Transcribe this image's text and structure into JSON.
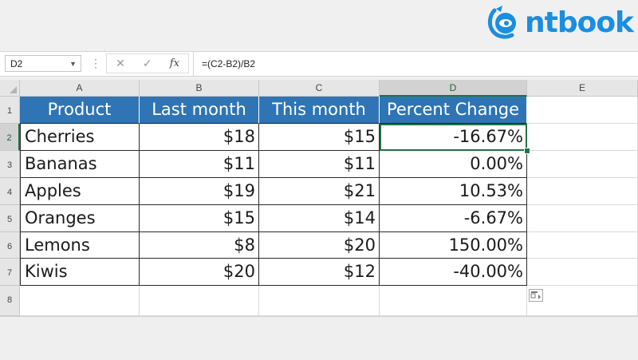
{
  "logo": {
    "text": "ntbook",
    "color": "#1a8ee0"
  },
  "formula_bar": {
    "name_box": "D2",
    "formula": "=(C2-B2)/B2",
    "icons": [
      "more-dots-icon",
      "cancel-icon",
      "enter-icon",
      "function-icon"
    ],
    "fx_label": "fx"
  },
  "columns": [
    "A",
    "B",
    "C",
    "D",
    "E"
  ],
  "rows": [
    "1",
    "2",
    "3",
    "4",
    "5",
    "6",
    "7",
    "8"
  ],
  "selected_cell": "D2",
  "table": {
    "headers": [
      "Product",
      "Last month",
      "This month",
      "Percent Change"
    ],
    "rows": [
      [
        "Cherries",
        "$18",
        "$15",
        "-16.67%"
      ],
      [
        "Bananas",
        "$11",
        "$11",
        "0.00%"
      ],
      [
        "Apples",
        "$19",
        "$21",
        "10.53%"
      ],
      [
        "Oranges",
        "$15",
        "$14",
        "-6.67%"
      ],
      [
        "Lemons",
        "$8",
        "$20",
        "150.00%"
      ],
      [
        "Kiwis",
        "$20",
        "$12",
        "-40.00%"
      ]
    ],
    "header_color": "#2f75b5",
    "accent_color": "#217346"
  }
}
